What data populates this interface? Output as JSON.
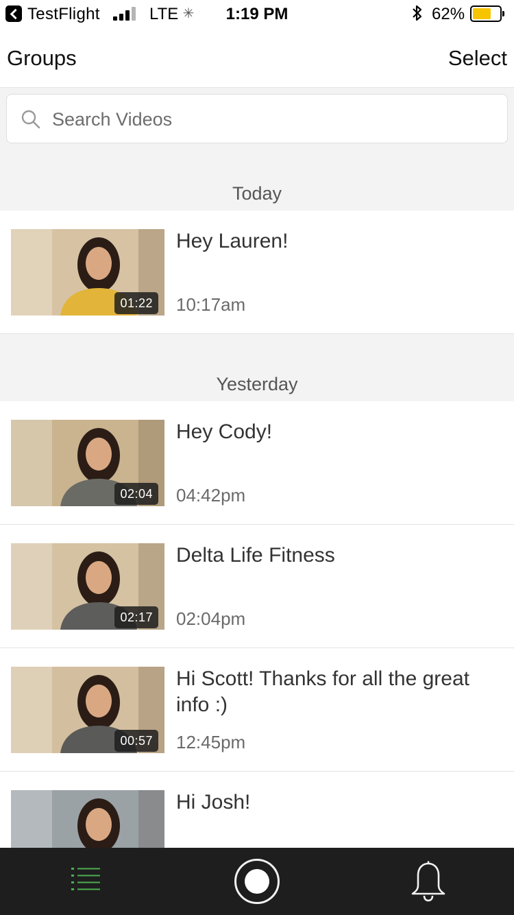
{
  "status_bar": {
    "back_app": "TestFlight",
    "network": "LTE",
    "time": "1:19 PM",
    "battery_pct": "62%",
    "battery_level": 0.62,
    "battery_color": "#f7c500",
    "signal_bars_filled": 3,
    "signal_bars_total": 4
  },
  "nav": {
    "left_label": "Groups",
    "right_label": "Select"
  },
  "search": {
    "placeholder": "Search Videos",
    "value": ""
  },
  "sections": [
    {
      "label": "Today",
      "items": [
        {
          "title": "Hey Lauren!",
          "time": "10:17am",
          "duration": "01:22",
          "shirt": "#e2b43a",
          "bg": "#d7c3a3"
        }
      ]
    },
    {
      "label": "Yesterday",
      "items": [
        {
          "title": "Hey Cody!",
          "time": "04:42pm",
          "duration": "02:04",
          "shirt": "#6b6b66",
          "bg": "#c9b48f"
        },
        {
          "title": "Delta Life Fitness",
          "time": "02:04pm",
          "duration": "02:17",
          "shirt": "#5d5d5b",
          "bg": "#d5c2a2"
        },
        {
          "title": "Hi Scott! Thanks for all the great info :)",
          "time": "12:45pm",
          "duration": "00:57",
          "shirt": "#5a5a58",
          "bg": "#d3bf9f"
        },
        {
          "title": "Hi Josh!",
          "time": "",
          "duration": "",
          "shirt": "#3c3c3c",
          "bg": "#9aa2a6"
        }
      ]
    }
  ],
  "tab_bar": {
    "icons": [
      "list-icon",
      "record-icon",
      "bell-icon"
    ],
    "active_color": "#4caf50",
    "bg_color": "#1e1e1e"
  }
}
